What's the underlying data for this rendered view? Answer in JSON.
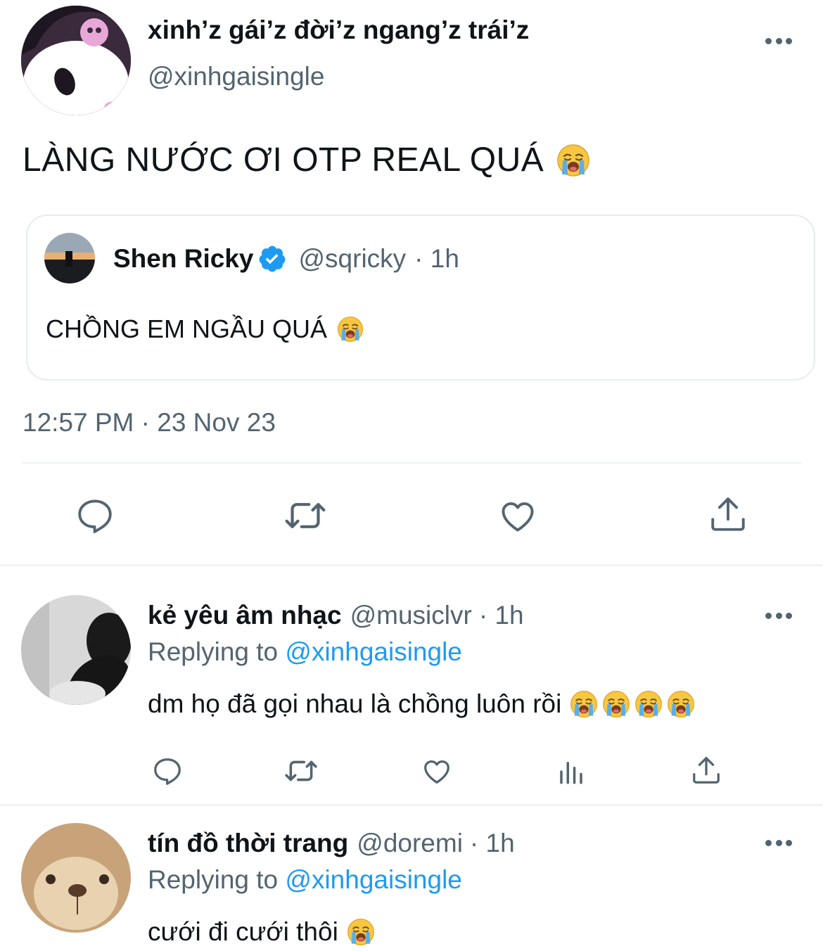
{
  "main_tweet": {
    "display_name": "xinh’z gái’z đời’z ngang’z trái’z",
    "handle": "@xinhgaisingle",
    "text": "LÀNG NƯỚC ƠI OTP REAL QUÁ",
    "emoji": "loudly-crying-face",
    "timestamp": "12:57 PM · 23 Nov 23",
    "quote": {
      "display_name": "Shen Ricky",
      "verified": true,
      "handle": "@sqricky",
      "time": "· 1h",
      "text": "CHỒNG EM NGẦU QUÁ",
      "emoji": "loudly-crying-face"
    },
    "actions": [
      "reply-icon",
      "retweet-icon",
      "like-icon",
      "share-icon"
    ]
  },
  "replies": [
    {
      "display_name": "kẻ yêu âm nhạc",
      "handle": "@musiclvr",
      "time": "· 1h",
      "replying_prefix": "Replying to",
      "replying_to": "@xinhgaisingle",
      "text": "dm họ đã gọi nhau là chồng luôn rồi",
      "emoji_count": 4,
      "actions": [
        "reply-icon",
        "retweet-icon",
        "like-icon",
        "analytics-icon",
        "share-icon"
      ]
    },
    {
      "display_name": "tín đồ thời trang",
      "handle": "@doremi",
      "time": "· 1h",
      "replying_prefix": "Replying to",
      "replying_to": "@xinhgaisingle",
      "text": "cưới đi cưới thôi",
      "emoji_count": 1
    }
  ],
  "colors": {
    "text": "#0f1419",
    "secondary": "#536471",
    "link": "#1d9bf0",
    "verified": "#1d9bf0",
    "divider": "#eff3f4"
  }
}
